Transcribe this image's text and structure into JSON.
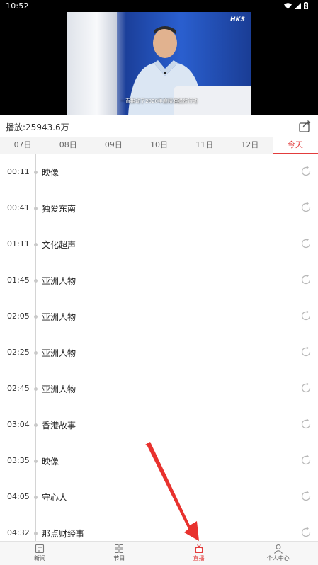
{
  "status_bar": {
    "time": "10:52"
  },
  "video": {
    "logo": "HKS",
    "caption": "一直推动了2020年度精准脱贫行动"
  },
  "play_info": {
    "label": "播放:25943.6万"
  },
  "tabs": [
    {
      "label": "07日"
    },
    {
      "label": "08日"
    },
    {
      "label": "09日"
    },
    {
      "label": "10日"
    },
    {
      "label": "11日"
    },
    {
      "label": "12日"
    },
    {
      "label": "今天"
    }
  ],
  "schedule": [
    {
      "time": "00:11",
      "title": "映像"
    },
    {
      "time": "00:41",
      "title": "独爱东南"
    },
    {
      "time": "01:11",
      "title": "文化超声"
    },
    {
      "time": "01:45",
      "title": "亚洲人物"
    },
    {
      "time": "02:05",
      "title": "亚洲人物"
    },
    {
      "time": "02:25",
      "title": "亚洲人物"
    },
    {
      "time": "02:45",
      "title": "亚洲人物"
    },
    {
      "time": "03:04",
      "title": "香港故事"
    },
    {
      "time": "03:35",
      "title": "映像"
    },
    {
      "time": "04:05",
      "title": "守心人"
    },
    {
      "time": "04:32",
      "title": "那点财经事"
    }
  ],
  "bottom_nav": [
    {
      "label": "新闻",
      "icon": "news-icon"
    },
    {
      "label": "节目",
      "icon": "grid-icon"
    },
    {
      "label": "直播",
      "icon": "tv-icon"
    },
    {
      "label": "个人中心",
      "icon": "user-icon"
    }
  ],
  "colors": {
    "accent": "#e23c3c",
    "arrow": "#e8322e"
  }
}
